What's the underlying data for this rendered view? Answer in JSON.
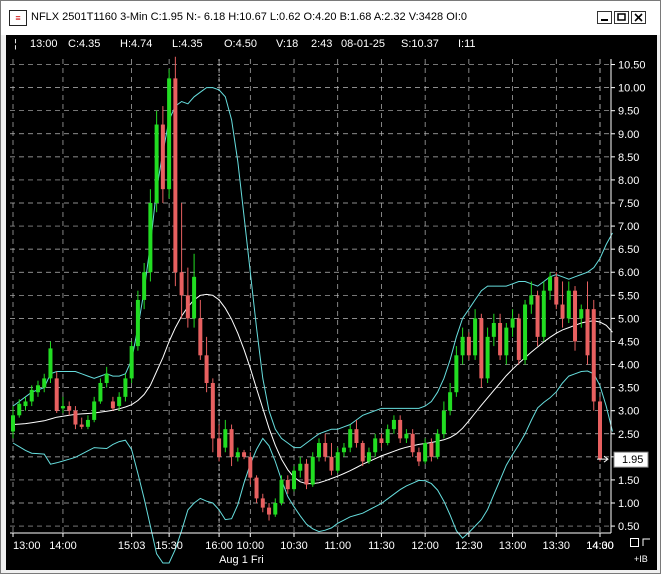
{
  "window": {
    "title": "NFLX 2501T1160 3-Min C:1.95 N:- 6.18 H:10.67 L:0.62 O:4.20 B:1.68 A:2.32 V:3428 OI:0",
    "icon": "chart-window-icon"
  },
  "info_bar": {
    "marker": "¦",
    "time": "13:00",
    "close": "C:4.35",
    "high": "H:4.74",
    "low": "L:4.35",
    "open": "O:4.50",
    "volume": "V:18",
    "bar_time": "2:43",
    "date": "08-01-25",
    "strike": "S:10.37",
    "iv": "I:11"
  },
  "price_label": "1.95",
  "session_label": "Aug 1 Fri",
  "corner_label": "+IB",
  "colors": {
    "up": "#22dd22",
    "down": "#e86060",
    "band": "#66dddd",
    "mid": "#ffffff",
    "grid": "#bbbbbb"
  },
  "chart_data": {
    "type": "candlestick",
    "ylim": [
      0.35,
      10.62
    ],
    "y_ticks": [
      "0.50",
      "1.00",
      "1.50",
      "2.00",
      "2.50",
      "3.00",
      "3.50",
      "4.00",
      "4.50",
      "5.00",
      "5.50",
      "6.00",
      "6.50",
      "7.00",
      "7.50",
      "8.00",
      "8.50",
      "9.00",
      "9.50",
      "10.00",
      "10.50"
    ],
    "x_ticks": [
      "13:00",
      "14:00",
      "15:03",
      "15:30",
      "16:00",
      "10:00",
      "10:30",
      "11:00",
      "11:30",
      "12:00",
      "12:30",
      "13:00",
      "13:30",
      "14:00",
      "14:30"
    ],
    "last_price": 1.95,
    "bars": [
      {
        "o": 2.55,
        "h": 3.1,
        "l": 2.4,
        "c": 2.9
      },
      {
        "o": 2.9,
        "h": 3.25,
        "l": 2.85,
        "c": 3.15
      },
      {
        "o": 3.1,
        "h": 3.3,
        "l": 3.0,
        "c": 3.2
      },
      {
        "o": 3.2,
        "h": 3.55,
        "l": 3.1,
        "c": 3.45
      },
      {
        "o": 3.4,
        "h": 3.65,
        "l": 3.3,
        "c": 3.55
      },
      {
        "o": 3.5,
        "h": 3.8,
        "l": 3.4,
        "c": 3.7
      },
      {
        "o": 3.7,
        "h": 4.5,
        "l": 3.6,
        "c": 4.35
      },
      {
        "o": 3.7,
        "h": 3.85,
        "l": 2.95,
        "c": 3.0
      },
      {
        "o": 3.05,
        "h": 3.3,
        "l": 2.95,
        "c": 3.1
      },
      {
        "o": 3.1,
        "h": 3.2,
        "l": 2.9,
        "c": 3.0
      },
      {
        "o": 3.0,
        "h": 3.1,
        "l": 2.6,
        "c": 2.7
      },
      {
        "o": 2.7,
        "h": 2.85,
        "l": 2.6,
        "c": 2.65
      },
      {
        "o": 2.65,
        "h": 2.9,
        "l": 2.6,
        "c": 2.8
      },
      {
        "o": 2.8,
        "h": 3.3,
        "l": 2.75,
        "c": 3.2
      },
      {
        "o": 3.2,
        "h": 3.7,
        "l": 3.15,
        "c": 3.6
      },
      {
        "o": 3.6,
        "h": 3.95,
        "l": 3.5,
        "c": 3.8
      },
      {
        "o": 3.2,
        "h": 3.3,
        "l": 3.0,
        "c": 3.05
      },
      {
        "o": 3.1,
        "h": 3.4,
        "l": 3.0,
        "c": 3.3
      },
      {
        "o": 3.3,
        "h": 3.8,
        "l": 3.2,
        "c": 3.7
      },
      {
        "o": 3.7,
        "h": 4.5,
        "l": 3.6,
        "c": 4.4
      },
      {
        "o": 4.4,
        "h": 5.6,
        "l": 4.3,
        "c": 5.4
      },
      {
        "o": 5.4,
        "h": 6.2,
        "l": 5.2,
        "c": 6.0
      },
      {
        "o": 6.0,
        "h": 7.8,
        "l": 5.8,
        "c": 7.5
      },
      {
        "o": 7.5,
        "h": 9.5,
        "l": 7.3,
        "c": 9.2
      },
      {
        "o": 9.2,
        "h": 9.6,
        "l": 7.5,
        "c": 7.8
      },
      {
        "o": 7.8,
        "h": 10.4,
        "l": 7.6,
        "c": 10.2
      },
      {
        "o": 10.2,
        "h": 10.67,
        "l": 5.7,
        "c": 6.0
      },
      {
        "o": 6.0,
        "h": 7.5,
        "l": 5.0,
        "c": 5.5
      },
      {
        "o": 5.5,
        "h": 6.1,
        "l": 4.8,
        "c": 5.0
      },
      {
        "o": 5.0,
        "h": 6.4,
        "l": 4.8,
        "c": 5.9
      },
      {
        "o": 5.0,
        "h": 5.4,
        "l": 4.1,
        "c": 4.2
      },
      {
        "o": 4.2,
        "h": 4.6,
        "l": 3.4,
        "c": 3.6
      },
      {
        "o": 3.6,
        "h": 3.7,
        "l": 2.1,
        "c": 2.4
      },
      {
        "o": 2.4,
        "h": 2.7,
        "l": 1.9,
        "c": 2.0
      },
      {
        "o": 2.2,
        "h": 2.8,
        "l": 2.1,
        "c": 2.6
      },
      {
        "o": 2.6,
        "h": 2.7,
        "l": 1.8,
        "c": 2.0
      },
      {
        "o": 2.0,
        "h": 2.2,
        "l": 1.9,
        "c": 2.1
      },
      {
        "o": 2.1,
        "h": 2.15,
        "l": 1.95,
        "c": 2.0
      },
      {
        "o": 2.0,
        "h": 2.1,
        "l": 1.4,
        "c": 1.55
      },
      {
        "o": 1.55,
        "h": 1.6,
        "l": 1.0,
        "c": 1.1
      },
      {
        "o": 1.1,
        "h": 1.2,
        "l": 0.8,
        "c": 0.9
      },
      {
        "o": 0.9,
        "h": 1.0,
        "l": 0.62,
        "c": 0.75
      },
      {
        "o": 0.75,
        "h": 1.1,
        "l": 0.7,
        "c": 1.0
      },
      {
        "o": 1.0,
        "h": 1.6,
        "l": 0.95,
        "c": 1.5
      },
      {
        "o": 1.5,
        "h": 1.6,
        "l": 1.2,
        "c": 1.3
      },
      {
        "o": 1.3,
        "h": 1.8,
        "l": 1.25,
        "c": 1.7
      },
      {
        "o": 1.7,
        "h": 2.0,
        "l": 1.55,
        "c": 1.85
      },
      {
        "o": 1.85,
        "h": 1.95,
        "l": 1.3,
        "c": 1.4
      },
      {
        "o": 1.4,
        "h": 2.1,
        "l": 1.35,
        "c": 2.0
      },
      {
        "o": 2.0,
        "h": 2.4,
        "l": 1.9,
        "c": 2.3
      },
      {
        "o": 2.3,
        "h": 2.5,
        "l": 1.9,
        "c": 2.0
      },
      {
        "o": 2.0,
        "h": 2.3,
        "l": 1.6,
        "c": 1.7
      },
      {
        "o": 1.7,
        "h": 2.2,
        "l": 1.65,
        "c": 2.1
      },
      {
        "o": 2.1,
        "h": 2.3,
        "l": 2.0,
        "c": 2.2
      },
      {
        "o": 2.2,
        "h": 2.7,
        "l": 2.1,
        "c": 2.6
      },
      {
        "o": 2.6,
        "h": 2.8,
        "l": 2.2,
        "c": 2.3
      },
      {
        "o": 2.3,
        "h": 2.35,
        "l": 1.8,
        "c": 1.9
      },
      {
        "o": 1.9,
        "h": 2.2,
        "l": 1.85,
        "c": 2.1
      },
      {
        "o": 2.1,
        "h": 2.5,
        "l": 2.0,
        "c": 2.4
      },
      {
        "o": 2.4,
        "h": 2.5,
        "l": 2.2,
        "c": 2.3
      },
      {
        "o": 2.3,
        "h": 2.7,
        "l": 2.25,
        "c": 2.6
      },
      {
        "o": 2.6,
        "h": 2.9,
        "l": 2.5,
        "c": 2.8
      },
      {
        "o": 2.8,
        "h": 2.9,
        "l": 2.3,
        "c": 2.4
      },
      {
        "o": 2.4,
        "h": 2.6,
        "l": 2.3,
        "c": 2.5
      },
      {
        "o": 2.5,
        "h": 2.6,
        "l": 2.0,
        "c": 2.1
      },
      {
        "o": 2.1,
        "h": 2.2,
        "l": 1.8,
        "c": 1.9
      },
      {
        "o": 1.9,
        "h": 2.4,
        "l": 1.85,
        "c": 2.3
      },
      {
        "o": 2.3,
        "h": 2.4,
        "l": 1.9,
        "c": 2.0
      },
      {
        "o": 2.0,
        "h": 2.6,
        "l": 1.95,
        "c": 2.5
      },
      {
        "o": 2.5,
        "h": 3.2,
        "l": 2.4,
        "c": 3.0
      },
      {
        "o": 3.0,
        "h": 3.6,
        "l": 2.9,
        "c": 3.4
      },
      {
        "o": 3.4,
        "h": 4.4,
        "l": 3.3,
        "c": 4.2
      },
      {
        "o": 4.2,
        "h": 4.8,
        "l": 4.0,
        "c": 4.6
      },
      {
        "o": 4.6,
        "h": 4.7,
        "l": 4.1,
        "c": 4.2
      },
      {
        "o": 4.2,
        "h": 5.2,
        "l": 4.1,
        "c": 5.0
      },
      {
        "o": 5.0,
        "h": 5.1,
        "l": 3.5,
        "c": 3.7
      },
      {
        "o": 3.7,
        "h": 4.8,
        "l": 3.6,
        "c": 4.6
      },
      {
        "o": 4.6,
        "h": 5.1,
        "l": 4.4,
        "c": 4.9
      },
      {
        "o": 4.9,
        "h": 5.1,
        "l": 4.1,
        "c": 4.2
      },
      {
        "o": 4.2,
        "h": 4.9,
        "l": 4.0,
        "c": 4.8
      },
      {
        "o": 4.8,
        "h": 5.2,
        "l": 4.6,
        "c": 5.0
      },
      {
        "o": 5.0,
        "h": 5.1,
        "l": 4.0,
        "c": 4.1
      },
      {
        "o": 4.1,
        "h": 5.4,
        "l": 4.0,
        "c": 5.3
      },
      {
        "o": 5.3,
        "h": 5.8,
        "l": 5.1,
        "c": 5.5
      },
      {
        "o": 5.5,
        "h": 5.6,
        "l": 4.4,
        "c": 4.6
      },
      {
        "o": 4.6,
        "h": 5.8,
        "l": 4.5,
        "c": 5.6
      },
      {
        "o": 5.6,
        "h": 6.0,
        "l": 5.4,
        "c": 5.9
      },
      {
        "o": 5.9,
        "h": 6.0,
        "l": 5.2,
        "c": 5.3
      },
      {
        "o": 5.3,
        "h": 5.8,
        "l": 4.8,
        "c": 5.0
      },
      {
        "o": 5.0,
        "h": 5.8,
        "l": 4.9,
        "c": 5.6
      },
      {
        "o": 5.6,
        "h": 5.7,
        "l": 4.3,
        "c": 4.5
      },
      {
        "o": 5.0,
        "h": 5.3,
        "l": 4.8,
        "c": 5.2
      },
      {
        "o": 5.2,
        "h": 5.8,
        "l": 4.0,
        "c": 4.2
      },
      {
        "o": 5.2,
        "h": 5.4,
        "l": 3.0,
        "c": 3.2
      },
      {
        "o": 3.2,
        "h": 3.3,
        "l": 1.9,
        "c": 1.95
      }
    ],
    "mid_band": [
      2.7,
      2.71,
      2.72,
      2.74,
      2.76,
      2.78,
      2.82,
      2.86,
      2.88,
      2.9,
      2.92,
      2.93,
      2.94,
      2.95,
      2.97,
      2.99,
      3.01,
      3.04,
      3.08,
      3.13,
      3.22,
      3.35,
      3.55,
      3.85,
      4.15,
      4.5,
      4.8,
      5.05,
      5.25,
      5.4,
      5.5,
      5.52,
      5.5,
      5.4,
      5.22,
      4.98,
      4.68,
      4.32,
      3.92,
      3.48,
      3.05,
      2.62,
      2.25,
      1.95,
      1.72,
      1.56,
      1.46,
      1.42,
      1.42,
      1.44,
      1.48,
      1.53,
      1.58,
      1.64,
      1.7,
      1.77,
      1.84,
      1.9,
      1.96,
      2.02,
      2.07,
      2.12,
      2.17,
      2.21,
      2.24,
      2.27,
      2.29,
      2.31,
      2.34,
      2.37,
      2.42,
      2.5,
      2.62,
      2.78,
      2.95,
      3.12,
      3.28,
      3.44,
      3.6,
      3.76,
      3.9,
      4.03,
      4.15,
      4.27,
      4.38,
      4.49,
      4.59,
      4.68,
      4.75,
      4.8,
      4.85,
      4.9,
      4.93,
      4.95,
      4.92,
      4.85,
      4.7
    ],
    "upper_band": [
      3.1,
      3.2,
      3.3,
      3.4,
      3.45,
      3.5,
      3.8,
      3.85,
      3.85,
      3.85,
      3.85,
      3.8,
      3.75,
      3.7,
      3.75,
      3.8,
      3.75,
      3.75,
      3.8,
      4.1,
      4.8,
      5.6,
      6.6,
      7.8,
      8.6,
      9.3,
      9.6,
      9.7,
      9.65,
      9.8,
      9.9,
      10.0,
      10.0,
      9.95,
      9.8,
      9.3,
      8.4,
      7.2,
      6.0,
      4.8,
      3.7,
      3.0,
      2.6,
      2.4,
      2.3,
      2.2,
      2.2,
      2.3,
      2.4,
      2.5,
      2.55,
      2.6,
      2.6,
      2.65,
      2.7,
      2.8,
      2.9,
      2.95,
      3.0,
      3.05,
      3.05,
      3.05,
      3.05,
      3.05,
      3.05,
      3.05,
      3.1,
      3.2,
      3.4,
      3.7,
      4.1,
      4.6,
      5.0,
      5.2,
      5.4,
      5.6,
      5.7,
      5.7,
      5.7,
      5.7,
      5.75,
      5.8,
      5.8,
      5.75,
      5.7,
      5.8,
      5.9,
      5.95,
      5.9,
      5.85,
      5.9,
      5.95,
      6.0,
      6.1,
      6.3,
      6.6,
      6.85
    ],
    "lower_band": [
      2.3,
      2.22,
      2.14,
      2.08,
      2.07,
      2.06,
      1.84,
      1.87,
      1.91,
      1.95,
      1.99,
      2.06,
      2.13,
      2.2,
      2.19,
      2.18,
      2.27,
      2.33,
      2.36,
      2.16,
      1.64,
      1.1,
      0.5,
      -0.1,
      -0.3,
      -0.3,
      0.0,
      0.4,
      0.85,
      1.0,
      1.1,
      1.04,
      1.0,
      0.85,
      0.64,
      0.66,
      0.96,
      1.44,
      1.84,
      2.16,
      2.4,
      2.24,
      1.9,
      1.5,
      1.14,
      0.92,
      0.72,
      0.54,
      0.44,
      0.38,
      0.41,
      0.46,
      0.56,
      0.63,
      0.7,
      0.74,
      0.78,
      0.85,
      0.92,
      0.99,
      1.09,
      1.19,
      1.29,
      1.37,
      1.43,
      1.49,
      1.48,
      1.42,
      1.28,
      1.04,
      0.74,
      0.4,
      0.24,
      0.36,
      0.5,
      0.64,
      0.86,
      1.18,
      1.5,
      1.82,
      2.05,
      2.26,
      2.5,
      2.79,
      3.06,
      3.18,
      3.28,
      3.41,
      3.6,
      3.75,
      3.8,
      3.85,
      3.86,
      3.8,
      3.54,
      3.1,
      2.55
    ]
  }
}
